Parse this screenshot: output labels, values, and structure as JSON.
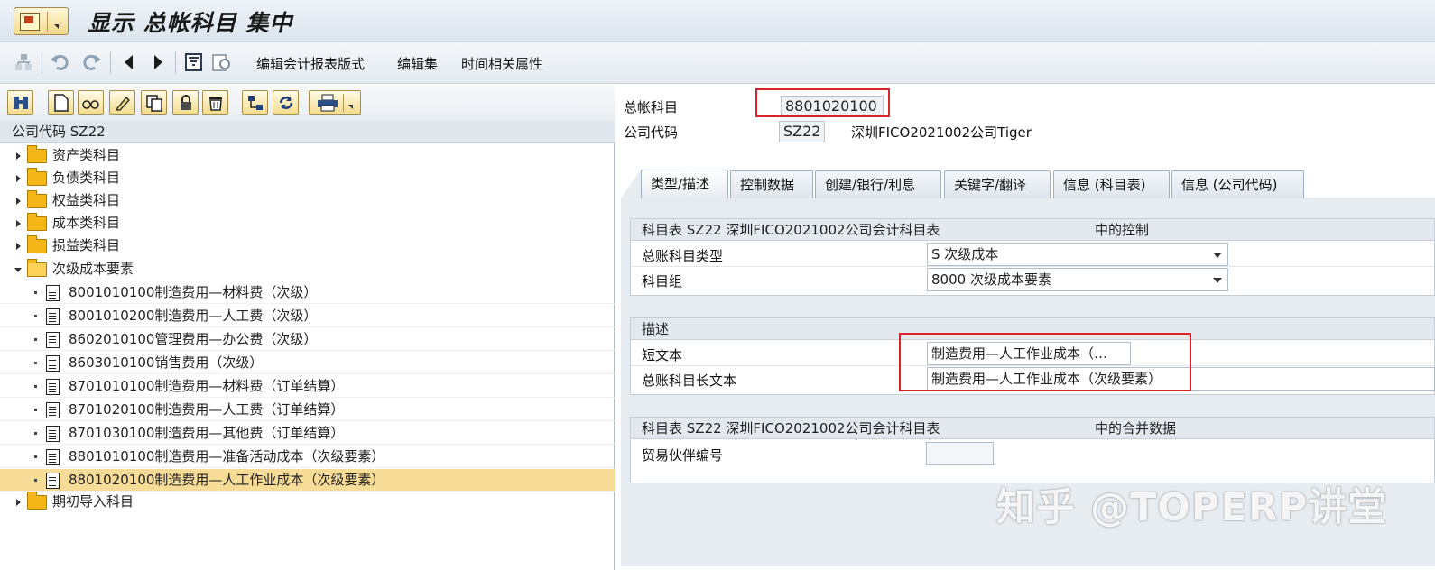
{
  "window": {
    "title": "显示 总帐科目 集中"
  },
  "app_toolbar": {
    "items": [
      "编辑会计报表版式",
      "编辑集",
      "时间相关属性"
    ]
  },
  "left_pane": {
    "tree_header": "公司代码 SZ22",
    "folders_top": [
      {
        "label": "资产类科目"
      },
      {
        "label": "负债类科目"
      },
      {
        "label": "权益类科目"
      },
      {
        "label": "成本类科目"
      },
      {
        "label": "损益类科目"
      }
    ],
    "open_folder": {
      "label": "次级成本要素"
    },
    "accounts": [
      {
        "label": "8001010100制造费用—材料费（次级）"
      },
      {
        "label": "8001010200制造费用—人工费（次级）"
      },
      {
        "label": "8602010100管理费用—办公费（次级）"
      },
      {
        "label": "8603010100销售费用（次级）"
      },
      {
        "label": "8701010100制造费用—材料费（订单结算）"
      },
      {
        "label": "8701020100制造费用—人工费（订单结算）"
      },
      {
        "label": "8701030100制造费用—其他费（订单结算）"
      },
      {
        "label": "8801010100制造费用—准备活动成本（次级要素）"
      },
      {
        "label": "8801020100制造费用—人工作业成本（次级要素）",
        "selected": true
      }
    ],
    "folders_bottom": [
      {
        "label": "期初导入科目"
      }
    ]
  },
  "header_fields": {
    "gl_account_label": "总帐科目",
    "gl_account_value": "8801020100",
    "company_code_label": "公司代码",
    "company_code_value": "SZ22",
    "company_name": "深圳FICO2021002公司Tiger"
  },
  "tabs": [
    {
      "label": "类型/描述",
      "active": true
    },
    {
      "label": "控制数据"
    },
    {
      "label": "创建/银行/利息"
    },
    {
      "label": "关键字/翻译"
    },
    {
      "label": "信息 (科目表)"
    },
    {
      "label": "信息 (公司代码)"
    }
  ],
  "group_control": {
    "title_left": "科目表 SZ22 深圳FICO2021002公司会计科目表",
    "title_right": "中的控制",
    "account_type_label": "总账科目类型",
    "account_type_value": "S 次级成本",
    "account_group_label": "科目组",
    "account_group_value": "8000 次级成本要素"
  },
  "group_description": {
    "title": "描述",
    "short_text_label": "短文本",
    "short_text_value": "制造费用—人工作业成本（…",
    "long_text_label": "总账科目长文本",
    "long_text_value": "制造费用—人工作业成本（次级要素）"
  },
  "group_consolidation": {
    "title_left": "科目表 SZ22 深圳FICO2021002公司会计科目表",
    "title_right": "中的合并数据",
    "partner_label": "贸易伙伴编号",
    "partner_value": ""
  },
  "watermark": "知乎 @TOPERP讲堂"
}
